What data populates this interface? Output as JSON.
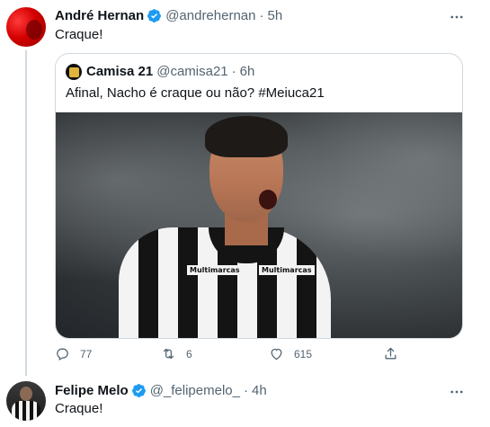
{
  "main_tweet": {
    "author": {
      "name": "André Hernan",
      "handle": "@andrehernan",
      "time": "5h"
    },
    "text": "Craque!",
    "quoted": {
      "author": {
        "name": "Camisa 21",
        "handle": "@camisa21",
        "time": "6h"
      },
      "text": "Afinal, Nacho é craque ou não? #Meiuca21",
      "image": {
        "sponsor_left": "Multimarcas",
        "sponsor_right": "Multimarcas"
      }
    },
    "actions": {
      "replies": "77",
      "retweets": "6",
      "likes": "615"
    }
  },
  "reply_tweet": {
    "author": {
      "name": "Felipe Melo",
      "handle": "@_felipemelo_",
      "time": "4h"
    },
    "text": "Craque!"
  },
  "colors": {
    "text": "#0f1419",
    "secondary": "#536471",
    "verified": "#1d9bf0",
    "border": "#cfd9de"
  },
  "icons": [
    "more-icon",
    "verified-icon",
    "reply-icon",
    "retweet-icon",
    "like-icon",
    "share-icon"
  ]
}
